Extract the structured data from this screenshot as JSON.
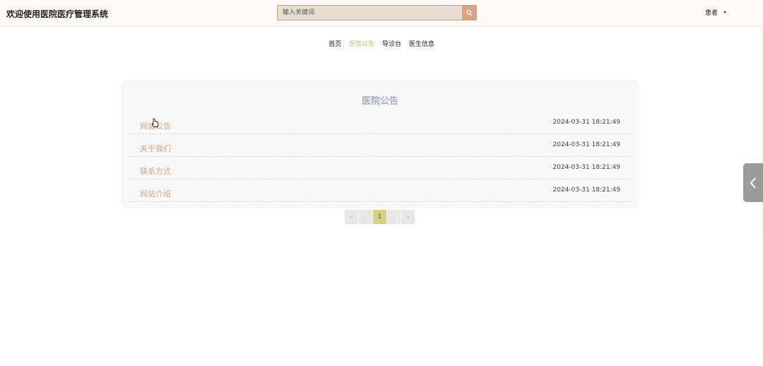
{
  "header": {
    "site_title": "欢迎使用医院医疗管理系统",
    "search": {
      "placeholder": "输入关键词",
      "icon": "search-icon"
    },
    "user": {
      "label": "患者",
      "icon": "chevron-down-icon"
    }
  },
  "nav": {
    "items": [
      {
        "label": "首页",
        "active": false
      },
      {
        "label": "医院公告",
        "active": true
      },
      {
        "label": "导诊台",
        "active": false
      },
      {
        "label": "医生信息",
        "active": false
      }
    ]
  },
  "announcements": {
    "title": "医院公告",
    "items": [
      {
        "title": "网站公告",
        "date": "2024-03-31 18:21:49"
      },
      {
        "title": "关于我们",
        "date": "2024-03-31 18:21:49"
      },
      {
        "title": "联系方式",
        "date": "2024-03-31 18:21:49"
      },
      {
        "title": "网站介绍",
        "date": "2024-03-31 18:21:49"
      }
    ]
  },
  "pagination": {
    "first": "«",
    "prev": "‹",
    "current": "1",
    "next": "›",
    "last": "»"
  },
  "side_toggle": {
    "icon": "chevron-left-icon"
  },
  "colors": {
    "accent": "#c9c46a",
    "link": "#dba887",
    "search_button": "#d9a485",
    "panel_title": "#a9adbe"
  }
}
